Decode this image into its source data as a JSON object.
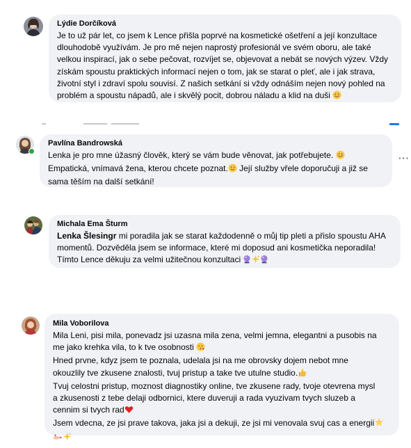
{
  "comments": [
    {
      "author": "Lýdie Dorčíková",
      "lines": [
        "Je to už pár let, co jsem k Lence přišla poprvé na kosmetické ošetření a její konzultace",
        "dlouhodobě využívám. Je pro mě nejen naprostý profesionál ve svém oboru, ale také",
        "velkou inspirací, jak o sebe pečovat, rozvíjet se, objevovat a nebát se nových výzev. Vždy",
        "získám spoustu praktických informací nejen o tom, jak se starat o pleť, ale i jak strava,",
        "životní styl i zdraví spolu souvisí. Z našich setkání si vždy odnáším nejen nový pohled na",
        "problém a spoustu nápadů, ale i skvělý pocit, dobrou náladu a klid na duši"
      ],
      "avatar_icon": "avatar-photo-dark-hair"
    },
    {
      "author": "Pavlína Bandrowská",
      "lines": [
        "Lenka je pro mne úžasný člověk, který se vám bude věnovat, jak potřebujete.",
        "Empatická, vnímavá žena, kterou chcete poznat.",
        "Její služby vřele doporučuji a již se",
        "sama těším na další setkání!"
      ],
      "avatar_icon": "avatar-photo-long-hair",
      "more_icon": "more-options-icon"
    },
    {
      "author": "Michala Ema Šturm",
      "tag": "Lenka Šlesingr",
      "lines": [
        "mi poradila jak se starat každodenně o můj tip pleti a přislo spoustu AHA",
        "momentů. Dozvěděla jsem se informace, které mi doposud ani kosmetička neporadila!",
        "Tímto Lence děkuju za velmi užitečnou konzultaci"
      ],
      "avatar_icon": "avatar-photo-group"
    },
    {
      "author": "Mila Voborilova",
      "lines": [
        "Mila Leni, pisi mila, ponevadz jsi uzasna mila zena, velmi jemna, elegantni a pusobis na",
        "me jako krehka vila, to k tve osobnosti",
        "Hned prvne, kdyz jsem te poznala, udelala jsi na me obrovsky dojem nebot mne",
        "okouzlily tve zkusene znalosti, tvuj pristup a take tve utulne studio.",
        "Tvuj celostni pristup, moznost diagnostiky online, tve zkusene rady, tvoje otevrena mysl",
        "a zkusenosti z tebe delaji odbornici, ktere duveruji a rada vyuzivam tvych sluzeb a",
        "cennim si tvych rad",
        "Jsem vdecna, ze jsi prave takova, jaka jsi a dekuji, ze jsi mi venovala svuj cas a energii"
      ],
      "avatar_icon": "avatar-photo-woman"
    }
  ],
  "emoji_names": [
    "smiling-face-icon",
    "crystal-ball-icon",
    "sparkles-icon",
    "winking-kiss-icon",
    "thumbs-up-icon",
    "red-heart-icon",
    "glowing-star-icon",
    "manicure-icon"
  ],
  "colors": {
    "bubble": "#f0f2f5",
    "text": "#050505",
    "online": "#31a24c",
    "meta": "#65676b"
  }
}
